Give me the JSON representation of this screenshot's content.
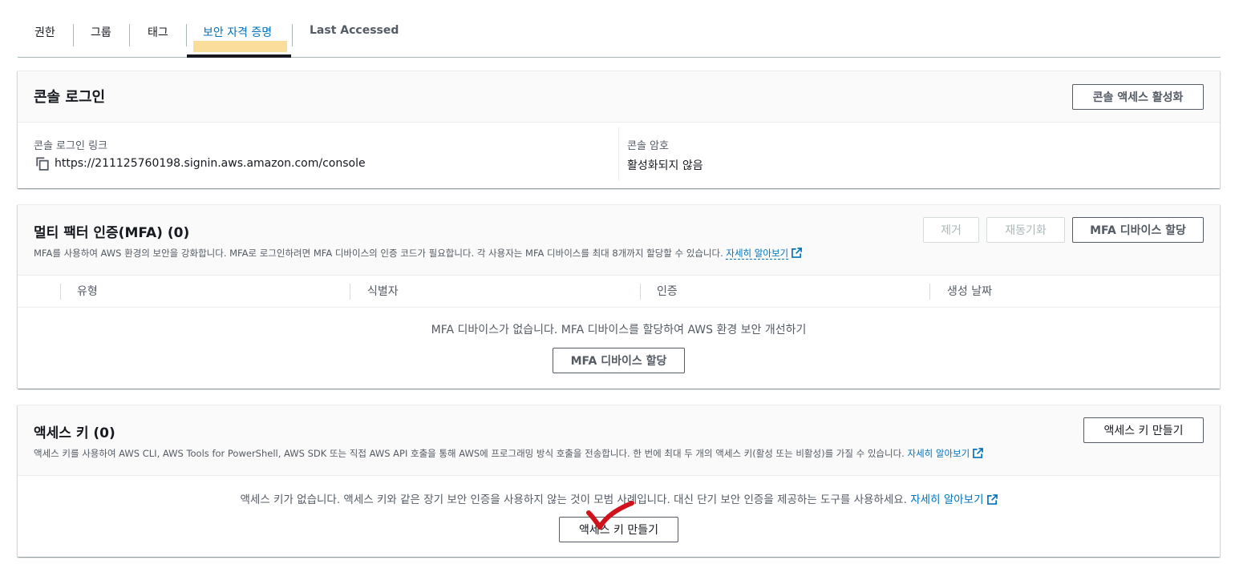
{
  "tabs": [
    {
      "label": "권한"
    },
    {
      "label": "그룹"
    },
    {
      "label": "태그"
    },
    {
      "label": "보안 자격 증명",
      "active": true
    },
    {
      "label": "Last Accessed"
    }
  ],
  "console_login": {
    "title": "콘솔 로그인",
    "enable_button": "콘솔 액세스 활성화",
    "link_label": "콘솔 로그인 링크",
    "link_value": "https://211125760198.signin.aws.amazon.com/console",
    "password_label": "콘솔 암호",
    "password_value": "활성화되지 않음"
  },
  "mfa": {
    "title": "멀티 팩터 인증(MFA) (0)",
    "description": "MFA를 사용하여 AWS 환경의 보안을 강화합니다. MFA로 로그인하려면 MFA 디바이스의 인증 코드가 필요합니다. 각 사용자는 MFA 디바이스를 최대 8개까지 할당할 수 있습니다.",
    "learn_more": "자세히 알아보기",
    "remove_button": "제거",
    "resync_button": "재동기화",
    "assign_button": "MFA 디바이스 할당",
    "columns": [
      "유형",
      "식별자",
      "인증",
      "생성 날짜"
    ],
    "empty_text": "MFA 디바이스가 없습니다. MFA 디바이스를 할당하여 AWS 환경 보안 개선하기",
    "empty_assign_button": "MFA 디바이스 할당"
  },
  "access_keys": {
    "title": "액세스 키 (0)",
    "description": "액세스 키를 사용하여 AWS CLI, AWS Tools for PowerShell, AWS SDK 또는 직접 AWS API 호출을 통해 AWS에 프로그래밍 방식 호출을 전송합니다. 한 번에 최대 두 개의 액세스 키(활성 또는 비활성)를 가질 수 있습니다.",
    "learn_more": "자세히 알아보기",
    "create_button": "액세스 키 만들기",
    "empty_text": "액세스 키가 없습니다. 액세스 키와 같은 장기 보안 인증을 사용하지 않는 것이 모범 사례입니다. 대신 단기 보안 인증을 제공하는 도구를 사용하세요.",
    "empty_learn_more": "자세히 알아보기",
    "empty_create_button": "액세스 키 만들기"
  },
  "colors": {
    "link": "#0073bb",
    "highlight": "#f9d78a",
    "checkmark": "#d0121b"
  },
  "icons": [
    "copy-icon",
    "external-link-icon",
    "checkmark-annotation"
  ]
}
